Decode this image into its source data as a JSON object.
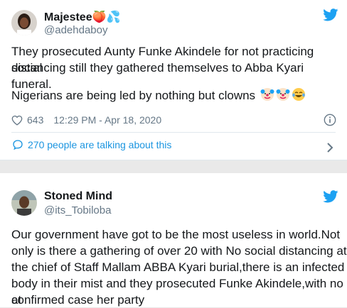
{
  "tweet1": {
    "name": "Majestee🍑💦",
    "handle": "@adehdaboy",
    "text_line1": "They prosecuted Aunty Funke Akindele for not practicing social",
    "text_line2": "distancing still they gathered themselves to Abba Kyari funeral.",
    "text_line3": "Nigerians are being led by nothing but clowns",
    "likes": "643",
    "timestamp": "12:29 PM - Apr 18, 2020",
    "talking": "270 people are talking about this",
    "emoji_icons": [
      "clown-face-icon",
      "clown-face-icon",
      "tears-of-joy-icon"
    ]
  },
  "tweet2": {
    "name": "Stoned Mind",
    "handle": "@its_Tobiloba",
    "lines": [
      "Our government have got to be the most useless in world.Not",
      "only is there a gathering of over 20 with No social distancing at",
      "the chief of Staff Mallam ABBA Kyari burial,there is an infected",
      "body in their mist and they prosecuted Funke Akindele,with no at",
      "confirmed case her party"
    ]
  },
  "colors": {
    "twitter_blue": "#1da1f2",
    "link_blue": "#1b95e0",
    "muted": "#657786"
  }
}
